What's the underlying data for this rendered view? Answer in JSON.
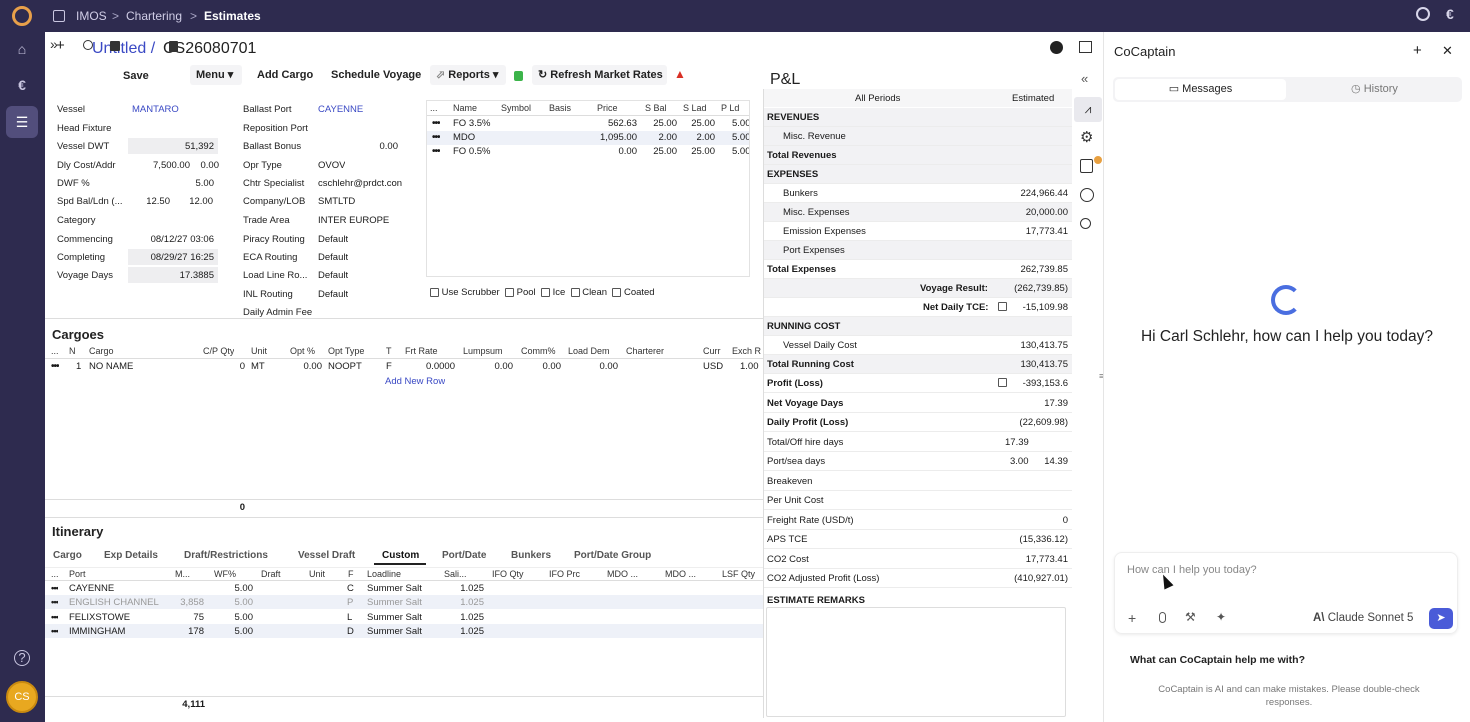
{
  "topbar": {
    "crumbs": [
      "IMOS",
      "Chartering",
      "Estimates"
    ],
    "seps": [
      ">",
      ">"
    ]
  },
  "header": {
    "untitled": "Untitled /",
    "estimate_id": "CS26080701"
  },
  "toolbar": {
    "save": "Save",
    "menu": "Menu",
    "add_cargo": "Add Cargo",
    "schedule_voyage": "Schedule Voyage",
    "reports": "Reports",
    "refresh": "Refresh Market Rates"
  },
  "vessel_fields": [
    {
      "label": "Vessel",
      "value": "MANTARO"
    },
    {
      "label": "Head Fixture",
      "value": ""
    },
    {
      "label": "Vessel DWT",
      "value": "51,392"
    },
    {
      "label": "Dly Cost/Addr",
      "value": "7,500.00",
      "value2": "0.00"
    },
    {
      "label": "DWF %",
      "value": "5.00"
    },
    {
      "label": "Spd Bal/Ldn (...",
      "value": "12.50",
      "value2": "12.00"
    },
    {
      "label": "Category",
      "value": ""
    },
    {
      "label": "Commencing",
      "value": "08/12/27 03:06"
    },
    {
      "label": "Completing",
      "value": "08/29/27 16:25"
    },
    {
      "label": "Voyage Days",
      "value": "17.3885"
    }
  ],
  "port_fields": [
    {
      "label": "Ballast Port",
      "value": "CAYENNE"
    },
    {
      "label": "Reposition Port",
      "value": ""
    },
    {
      "label": "Ballast Bonus",
      "value": "0.00"
    },
    {
      "label": "Opr Type",
      "value": "OVOV"
    },
    {
      "label": "Chtr Specialist",
      "value": "cschlehr@prdct.con"
    },
    {
      "label": "Company/LOB",
      "value": "SMTLTD"
    },
    {
      "label": "Trade Area",
      "value": "INTER EUROPE"
    },
    {
      "label": "Piracy Routing",
      "value": "Default"
    },
    {
      "label": "ECA Routing",
      "value": "Default"
    },
    {
      "label": "Load Line Ro...",
      "value": "Default"
    },
    {
      "label": "INL Routing",
      "value": "Default"
    },
    {
      "label": "Daily Admin Fee",
      "value": ""
    }
  ],
  "bunkers": {
    "headers": [
      "...",
      "Name",
      "Symbol",
      "Basis",
      "Price",
      "S Bal",
      "S Lad",
      "P Ld"
    ],
    "rows": [
      {
        "dots": "•••",
        "name": "FO 3.5%",
        "price": "562.63",
        "sbal": "25.00",
        "slad": "25.00",
        "pld": "5.00"
      },
      {
        "dots": "•••",
        "name": "MDO",
        "price": "1,095.00",
        "sbal": "2.00",
        "slad": "2.00",
        "pld": "5.00"
      },
      {
        "dots": "•••",
        "name": "FO 0.5%",
        "price": "0.00",
        "sbal": "25.00",
        "slad": "25.00",
        "pld": "5.00"
      }
    ]
  },
  "checkboxes": [
    "Use Scrubber",
    "Pool",
    "Ice",
    "Clean",
    "Coated"
  ],
  "cargoes": {
    "title": "Cargoes",
    "headers": [
      "...",
      "N",
      "Cargo",
      "C/P Qty",
      "Unit",
      "Opt %",
      "Opt Type",
      "T",
      "Frt Rate",
      "Lumpsum",
      "Comm%",
      "Load Dem",
      "Charterer",
      "Curr",
      "Exch R"
    ],
    "row": {
      "dots": "•••",
      "n": "1",
      "cargo": "NO NAME",
      "qty": "0",
      "unit": "MT",
      "opt": "0.00",
      "opttype": "NOOPT",
      "t": "F",
      "frt": "0.0000",
      "lump": "0.00",
      "comm": "0.00",
      "dem": "0.00",
      "curr": "USD",
      "exch": "1.00"
    },
    "add_row": "Add New Row",
    "total": "0"
  },
  "itinerary": {
    "title": "Itinerary",
    "tabs": [
      "Cargo",
      "Exp Details",
      "Draft/Restrictions",
      "Vessel Draft",
      "Custom",
      "Port/Date",
      "Bunkers",
      "Port/Date Group"
    ],
    "headers": [
      "...",
      "Port",
      "M...",
      "WF%",
      "Draft",
      "Unit",
      "F",
      "Loadline",
      "Sali...",
      "IFO Qty",
      "IFO Prc",
      "MDO ...",
      "MDO ...",
      "LSF Qty"
    ],
    "rows": [
      {
        "dots": "•••",
        "port": "CAYENNE",
        "m": "",
        "wf": "5.00",
        "f": "C",
        "loadline": "Summer Salt",
        "sali": "1.025"
      },
      {
        "dots": "•••",
        "port": "ENGLISH CHANNEL",
        "m": "3,858",
        "wf": "5.00",
        "f": "P",
        "loadline": "Summer Salt",
        "sali": "1.025"
      },
      {
        "dots": "•••",
        "port": "FELIXSTOWE",
        "m": "75",
        "wf": "5.00",
        "f": "L",
        "loadline": "Summer Salt",
        "sali": "1.025"
      },
      {
        "dots": "•••",
        "port": "IMMINGHAM",
        "m": "178",
        "wf": "5.00",
        "f": "D",
        "loadline": "Summer Salt",
        "sali": "1.025"
      }
    ],
    "total": "4,111"
  },
  "pl": {
    "title": "P&L",
    "col1": "All Periods",
    "col2": "Estimated",
    "rows": [
      {
        "label": "REVENUES",
        "value": ""
      },
      {
        "label": "Misc. Revenue",
        "value": ""
      },
      {
        "label": "Total Revenues",
        "value": ""
      },
      {
        "label": "EXPENSES",
        "value": ""
      },
      {
        "label": "Bunkers",
        "value": "224,966.44"
      },
      {
        "label": "Misc. Expenses",
        "value": "20,000.00"
      },
      {
        "label": "Emission Expenses",
        "value": "17,773.41"
      },
      {
        "label": "Port Expenses",
        "value": ""
      },
      {
        "label": "Total Expenses",
        "value": "262,739.85"
      },
      {
        "label": "Voyage Result:",
        "value": "(262,739.85)"
      },
      {
        "label": "Net Daily TCE:",
        "value": "-15,109.98"
      },
      {
        "label": "RUNNING COST",
        "value": ""
      },
      {
        "label": "Vessel Daily Cost",
        "value": "130,413.75"
      },
      {
        "label": "Total Running Cost",
        "value": "130,413.75"
      },
      {
        "label": "Profit (Loss)",
        "value": "-393,153.6"
      },
      {
        "label": "Net Voyage Days",
        "value": "17.39"
      },
      {
        "label": "Daily Profit (Loss)",
        "value": "(22,609.98)"
      },
      {
        "label": "Total/Off hire days",
        "value": "17.39"
      },
      {
        "label": "Port/sea days",
        "value": "3.00",
        "value2": "14.39"
      },
      {
        "label": "Breakeven",
        "value": ""
      },
      {
        "label": "Per Unit Cost",
        "value": ""
      },
      {
        "label": "Freight Rate (USD/t)",
        "value": "0"
      },
      {
        "label": "APS TCE",
        "value": "(15,336.12)"
      },
      {
        "label": "CO2 Cost",
        "value": "17,773.41"
      },
      {
        "label": "CO2 Adjusted Profit (Loss)",
        "value": "(410,927.01)"
      }
    ],
    "remarks": "ESTIMATE REMARKS"
  },
  "cocaptain": {
    "title": "CoCaptain",
    "tab_messages": "Messages",
    "tab_history": "History",
    "greeting": "Hi Carl Schlehr, how can I help you today?",
    "placeholder": "How can I help you today?",
    "model": "Claude Sonnet 5",
    "suggestion": "What can CoCaptain help me with?",
    "disclaimer": "CoCaptain is AI and can make mistakes. Please double-check responses."
  },
  "user": {
    "initials": "CS"
  },
  "colors": {
    "nav": "#2e2b4f",
    "accent": "#3a49c4",
    "send": "#4a5bd8",
    "avatar": "#e8a820"
  }
}
